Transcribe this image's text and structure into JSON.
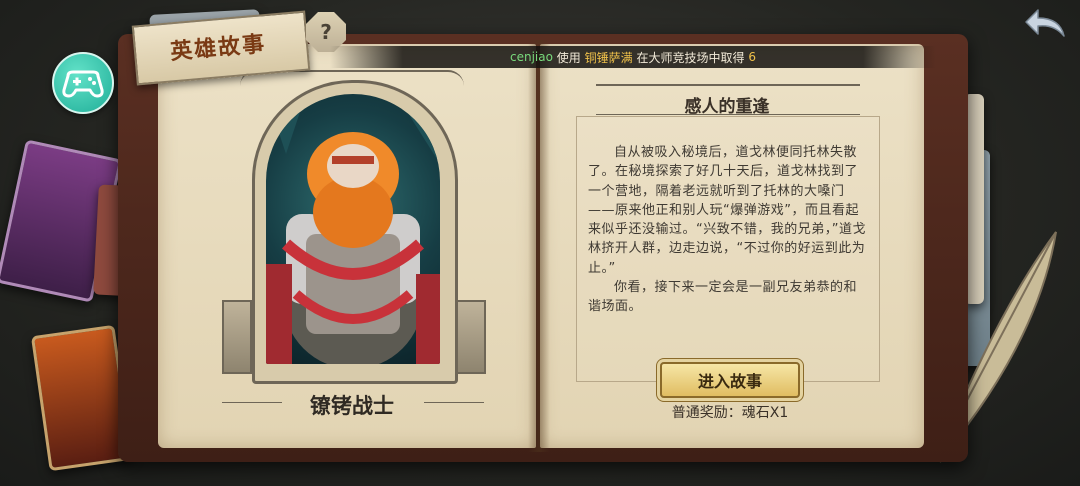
{
  "header": {
    "title": "英雄故事",
    "help_icon": "?"
  },
  "ticker": {
    "user": "cenjiao",
    "verb": "使用",
    "hero": "铜锤萨满",
    "context": "在大师竞技场中取得",
    "count": "6"
  },
  "hero": {
    "name": "镣铐战士"
  },
  "story": {
    "title": "感人的重逢",
    "paragraphs": [
      "自从被吸入秘境后，道戈林便同托林失散了。在秘境探索了好几十天后，道戈林找到了一个营地，隔着老远就听到了托林的大嗓门——原来他正和别人玩“爆弹游戏”，而且看起来似乎还没输过。“兴致不错，我的兄弟，”道戈林挤开人群，边走边说，“不过你的好运到此为止。”",
      "你看，接下来一定会是一副兄友弟恭的和谐场面。"
    ]
  },
  "actions": {
    "enter_label": "进入故事"
  },
  "reward": {
    "text": "普通奖励：魂石X1"
  },
  "icons": {
    "gamepad": "gamepad-icon",
    "back": "back-arrow-icon",
    "help": "question-icon"
  },
  "colors": {
    "accent_gold": "#f0c14a",
    "user_green": "#79d97c",
    "gamepad_teal": "#1fae98"
  }
}
